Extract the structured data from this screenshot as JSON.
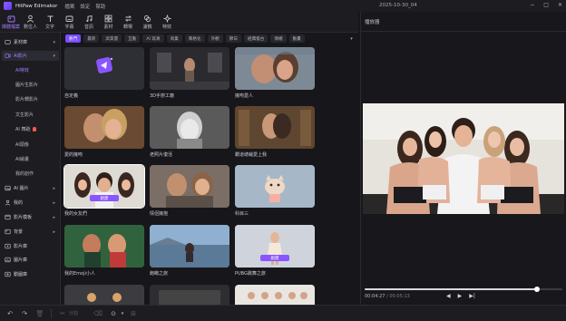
{
  "titlebar": {
    "app_title": "HitPaw Edimakor",
    "menus": [
      "檔案",
      "設定",
      "幫助"
    ],
    "window_title": "2025-10-30_04",
    "controls": [
      "−",
      "□",
      "✕"
    ]
  },
  "toolbar": {
    "tools": [
      {
        "label": "媒體檔案",
        "icon": "media-icon",
        "active": true
      },
      {
        "label": "數位人",
        "icon": "avatar-icon",
        "active": false
      },
      {
        "label": "文字",
        "icon": "text-icon",
        "active": false
      },
      {
        "label": "字幕",
        "icon": "subtitle-icon",
        "active": false
      },
      {
        "label": "音訊",
        "icon": "audio-icon",
        "active": false
      },
      {
        "label": "素材",
        "icon": "assets-icon",
        "active": false
      },
      {
        "label": "轉場",
        "icon": "transition-icon",
        "active": false
      },
      {
        "label": "濾鏡",
        "icon": "filter-icon",
        "active": false
      },
      {
        "label": "特效",
        "icon": "effects-icon",
        "active": false
      }
    ]
  },
  "sidebar": {
    "items": [
      {
        "label": "素材庫",
        "icon": "library-icon",
        "arrow": "▾"
      },
      {
        "label": "AI影片",
        "icon": "ai-video-icon",
        "arrow": "▾",
        "selected": true
      },
      {
        "label": "AI 圖片",
        "icon": "ai-image-icon",
        "arrow": "▸"
      },
      {
        "label": "我的",
        "icon": "mine-icon",
        "arrow": "▸"
      },
      {
        "label": "影片模板",
        "icon": "template-icon",
        "arrow": "▸"
      },
      {
        "label": "背景",
        "icon": "background-icon",
        "arrow": "▸"
      },
      {
        "label": "影片庫",
        "icon": "video-library-icon",
        "arrow": ""
      },
      {
        "label": "圖片庫",
        "icon": "image-library-icon",
        "arrow": ""
      },
      {
        "label": "動圖庫",
        "icon": "gif-library-icon",
        "arrow": ""
      }
    ],
    "sub_items": [
      {
        "label": "AI特效",
        "active": true
      },
      {
        "label": "圖片生影片",
        "active": false
      },
      {
        "label": "影片轉影片",
        "active": false
      },
      {
        "label": "文生影片",
        "active": false
      },
      {
        "label": "AI 舞蹈",
        "active": false,
        "hot": true
      },
      {
        "label": "AI頭像",
        "active": false
      },
      {
        "label": "AI繪畫",
        "active": false
      },
      {
        "label": "我的創作",
        "active": false
      }
    ]
  },
  "categories": [
    {
      "label": "熱門",
      "active": true
    },
    {
      "label": "最新",
      "active": false
    },
    {
      "label": "高質量",
      "active": false
    },
    {
      "label": "互動",
      "active": false
    },
    {
      "label": "AI 寫真",
      "active": false
    },
    {
      "label": "商業",
      "active": false
    },
    {
      "label": "風格化",
      "active": false
    },
    {
      "label": "外觀",
      "active": false
    },
    {
      "label": "節日",
      "active": false
    },
    {
      "label": "經典復古",
      "active": false
    },
    {
      "label": "情緒",
      "active": false
    },
    {
      "label": "動畫",
      "active": false
    }
  ],
  "cards": [
    {
      "label": "自定義",
      "kind": "custom"
    },
    {
      "label": "3D手辦工廠",
      "kind": "gallery"
    },
    {
      "label": "擁吻愛人",
      "kind": "kiss"
    },
    {
      "label": "愛的擁吻",
      "kind": "couple"
    },
    {
      "label": "老照片復活",
      "kind": "oldphoto"
    },
    {
      "label": "霸道總裁愛上我",
      "kind": "library"
    },
    {
      "label": "我的女友們",
      "kind": "girlfriends",
      "selected": true,
      "button": "創建"
    },
    {
      "label": "情侶擁抱",
      "kind": "hug"
    },
    {
      "label": "科目三",
      "kind": "cat"
    },
    {
      "label": "我的Emoji小人",
      "kind": "emoji"
    },
    {
      "label": "飽瞰之旅",
      "kind": "lake"
    },
    {
      "label": "PUBG跳舞之旅",
      "kind": "pubg",
      "button": "創建"
    },
    {
      "label": "",
      "kind": "bottom1"
    },
    {
      "label": "",
      "kind": "bottom2"
    },
    {
      "label": "",
      "kind": "bottom3"
    }
  ],
  "preview": {
    "header": "播放器",
    "current_time": "00:04:27",
    "separator": " / ",
    "total_time": "00:05:13",
    "progress": 0.87,
    "controls": [
      "◀",
      "▶",
      "▶|"
    ]
  },
  "bottombar": {
    "split_label": "分割"
  }
}
